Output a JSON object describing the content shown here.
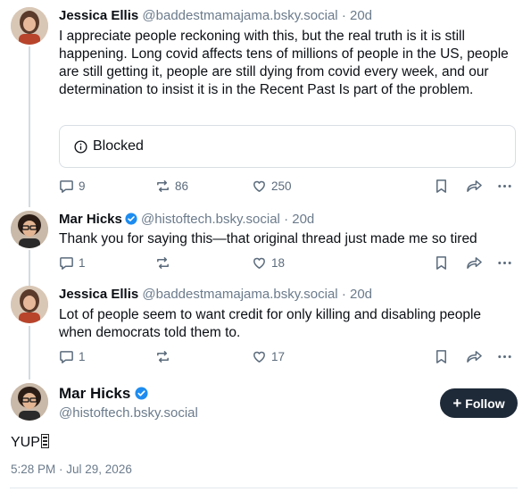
{
  "posts": [
    {
      "author": "Jessica Ellis",
      "handle": "@baddestmamajama.bsky.social",
      "separator": "·",
      "age": "20d",
      "text": "I appreciate people reckoning with this, but the real truth is it is still happening. Long covid affects tens of millions of people in the US, people are still getting it, people are still dying from covid every week, and our determination to insist it is in the Recent Past Is part of the problem.",
      "embed_label": "Blocked",
      "replies": "9",
      "reposts": "",
      "repost_count": "86",
      "likes": "250"
    },
    {
      "author": "Mar Hicks",
      "handle": "@histoftech.bsky.social",
      "separator": "·",
      "age": "20d",
      "text": "Thank you for saying this—that original thread just made me so tired",
      "replies": "1",
      "likes": "18"
    },
    {
      "author": "Jessica Ellis",
      "handle": "@baddestmamajama.bsky.social",
      "separator": "·",
      "age": "20d",
      "text": "Lot of people seem to want credit for only killing and disabling people when democrats told them to.",
      "replies": "1",
      "likes": "17"
    }
  ],
  "main_post": {
    "author": "Mar Hicks",
    "handle": "@histoftech.bsky.social",
    "follow_label": "Follow",
    "text": "YUP",
    "timestamp": "5:28 PM · Jul 29, 2026"
  },
  "colors": {
    "verified": "#1d8cf0",
    "follow_bg": "#1e2a38",
    "muted": "#6b7b8c"
  }
}
